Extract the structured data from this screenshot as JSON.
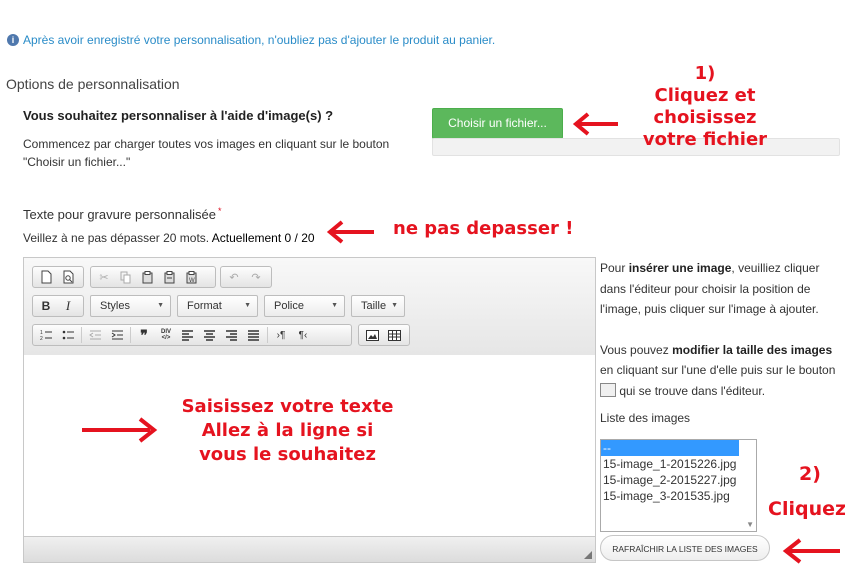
{
  "notice": {
    "text": "Après avoir enregistré votre personnalisation, n'oubliez pas d'ajouter le produit au panier.",
    "icon": "info-icon"
  },
  "options": {
    "title": "Options de personnalisation"
  },
  "image_section": {
    "question": "Vous souhaitez personnaliser à l'aide d'image(s) ?",
    "help": "Commencez par charger toutes vos images en cliquant sur le bouton \"Choisir un fichier...\"",
    "choose_button": "Choisir un fichier..."
  },
  "engraving": {
    "title": "Texte pour gravure personnalisée",
    "required_mark": "*",
    "limit_text": "Veillez à ne pas dépasser 20 mots.",
    "current_label": "Actuellement",
    "current_value": "0 / 20"
  },
  "editor": {
    "combos": [
      "Styles",
      "Format",
      "Police",
      "Taille"
    ]
  },
  "side_help": {
    "p1_a": "Pour ",
    "p1_b": "insérer une image",
    "p1_c": ", veuilliez cliquer dans l'éditeur pour choisir la position de l'image, puis cliquer sur l'image à ajouter.",
    "p2_a": "Vous pouvez ",
    "p2_b": "modifier la taille des images",
    "p2_c": " en cliquant sur l'une d'elle puis sur le bouton ",
    "p2_d": " qui se trouve dans l'éditeur."
  },
  "image_list": {
    "label": "Liste des images",
    "options": [
      "--",
      "15-image_1-2015226.jpg",
      "15-image_2-2015227.jpg",
      "15-image_3-201535.jpg"
    ],
    "refresh_button": "RAFRAÎCHIR LA LISTE DES IMAGES"
  },
  "annotations": {
    "step1_num": "1)",
    "step1_text_a": "Cliquez et choisissez",
    "step1_text_b": "votre fichier",
    "no_exceed": "ne pas depasser !",
    "type_text_a": "Saisissez votre texte",
    "type_text_b": "Allez à la ligne si",
    "type_text_c": "vous le souhaitez",
    "step2_num": "2)",
    "step2_text": "Cliquez",
    "color": "#e5131f"
  }
}
